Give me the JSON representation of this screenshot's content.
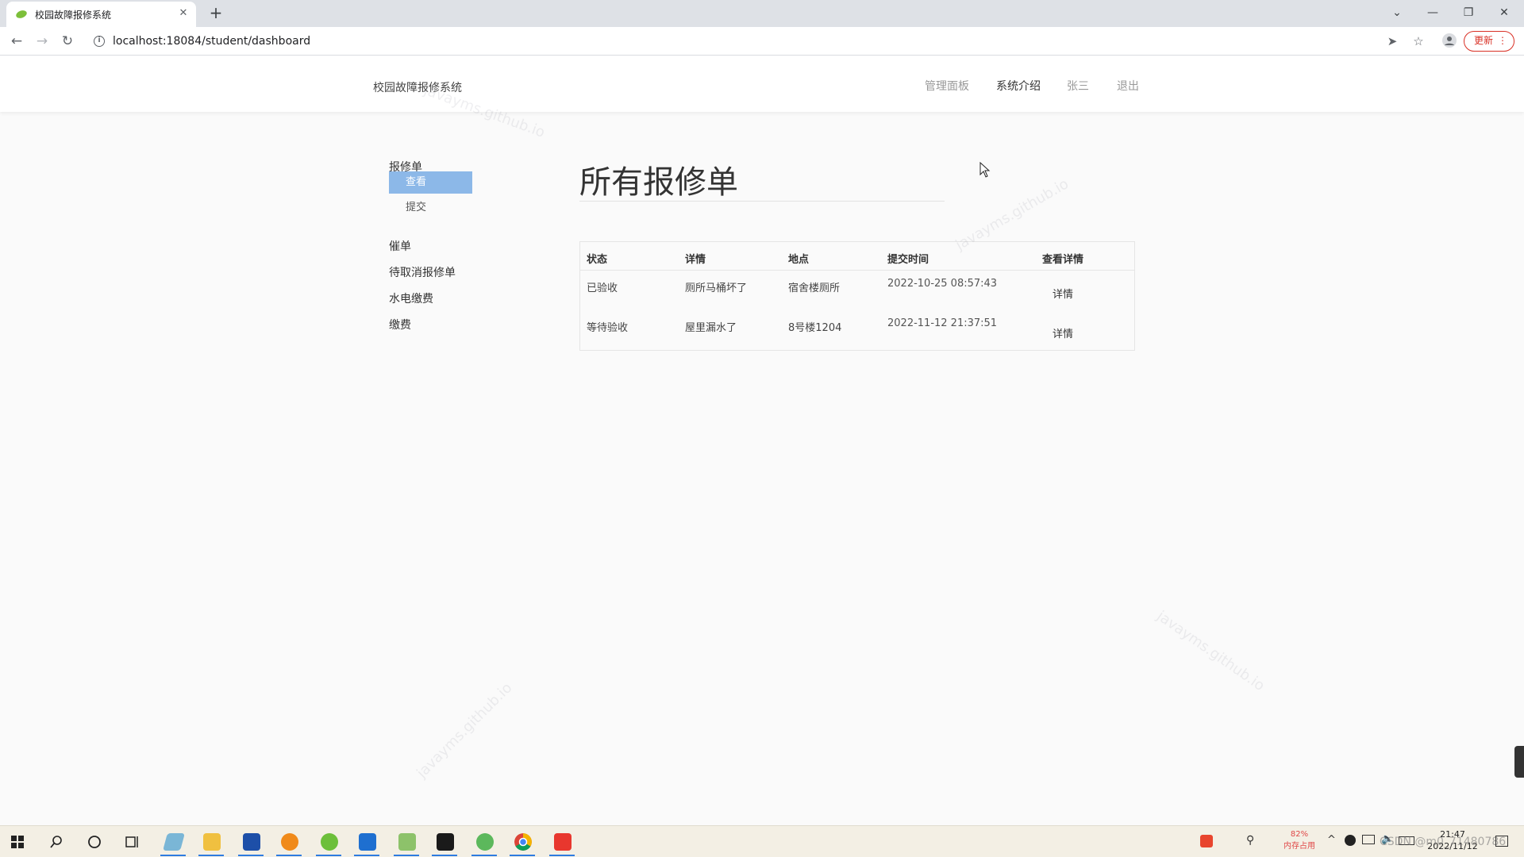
{
  "browser": {
    "tab_title": "校园故障报修系统",
    "tab_close_glyph": "✕",
    "new_tab_glyph": "+",
    "url": "localhost:18084/student/dashboard",
    "update_label": "更新",
    "controls": {
      "minimize": "—",
      "restore": "❐",
      "close": "✕",
      "tab_search": "⌄"
    }
  },
  "header": {
    "brand": "校园故障报修系统",
    "nav": [
      "管理面板",
      "系统介绍",
      "张三",
      "退出"
    ]
  },
  "sidebar": {
    "group_repair": "报修单",
    "sub_view": "查看",
    "sub_submit": "提交",
    "urge": "催单",
    "pending_cancel": "待取消报修单",
    "utilities": "水电缴费",
    "pay": "缴费"
  },
  "main": {
    "title": "所有报修单",
    "columns": [
      "状态",
      "详情",
      "地点",
      "提交时间",
      "查看详情"
    ],
    "rows": [
      {
        "status": "已验收",
        "detail": "厕所马桶坏了",
        "location": "宿舍楼厕所",
        "time": "2022-10-25 08:57:43",
        "action": "详情"
      },
      {
        "status": "等待验收",
        "detail": "屋里漏水了",
        "location": "8号楼1204",
        "time": "2022-11-12 21:37:51",
        "action": "详情"
      }
    ]
  },
  "watermarks": [
    "javayms.github.io",
    "javayms.github.io",
    "javayms.github.io",
    "javayms.github.io"
  ],
  "taskbar": {
    "memory_percent": "82%",
    "memory_label": "内存占用",
    "time": "21:47",
    "date": "2022/11/12",
    "csdn_text": "CSDN @m0_71480786"
  }
}
